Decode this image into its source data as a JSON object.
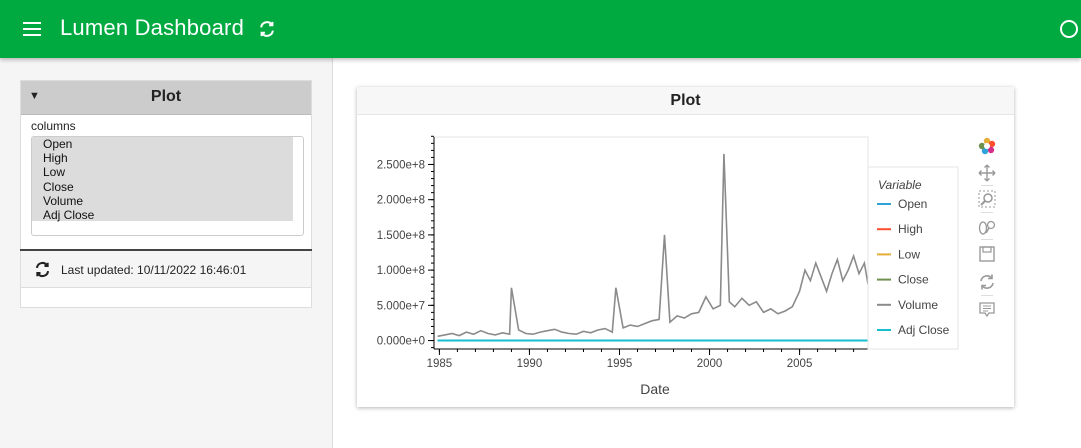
{
  "header": {
    "title": "Lumen Dashboard",
    "menu_icon": "hamburger-menu-icon",
    "refresh_icon": "refresh-icon",
    "bg_color": "#00aa41"
  },
  "sidebar": {
    "card_title": "Plot",
    "collapse_symbol": "▼",
    "columns_label": "columns",
    "options": [
      "Open",
      "High",
      "Low",
      "Close",
      "Volume",
      "Adj Close"
    ],
    "last_updated": "Last updated: 10/11/2022 16:46:01"
  },
  "main": {
    "plot_title": "Plot"
  },
  "chart_data": {
    "type": "line",
    "xlabel": "Date",
    "ylabel": "",
    "xlim": [
      1984.7,
      2008.8
    ],
    "ylim": [
      -12000000.0,
      289000000.0
    ],
    "x_ticks": [
      1985,
      1990,
      1995,
      2000,
      2005
    ],
    "y_ticks": [
      {
        "value": 0,
        "label": "0.000e+0"
      },
      {
        "value": 50000000,
        "label": "5.000e+7"
      },
      {
        "value": 100000000,
        "label": "1.000e+8"
      },
      {
        "value": 150000000,
        "label": "1.500e+8"
      },
      {
        "value": 200000000,
        "label": "2.000e+8"
      },
      {
        "value": 250000000,
        "label": "2.500e+8"
      }
    ],
    "legend_title": "Variable",
    "legend_position": "right",
    "series": [
      {
        "name": "Open",
        "color": "#30a2da",
        "x": [
          1984.9,
          2008.8
        ],
        "y": [
          0,
          0
        ]
      },
      {
        "name": "High",
        "color": "#fc4f30",
        "x": [
          1984.9,
          2008.8
        ],
        "y": [
          0,
          0
        ]
      },
      {
        "name": "Low",
        "color": "#e5ae38",
        "x": [
          1984.9,
          2008.8
        ],
        "y": [
          0,
          0
        ]
      },
      {
        "name": "Close",
        "color": "#6d904f",
        "x": [
          1984.9,
          2008.8
        ],
        "y": [
          0,
          0
        ]
      },
      {
        "name": "Volume",
        "color": "#8b8b8b",
        "x": [
          1984.9,
          1985.3,
          1985.7,
          1986.1,
          1986.5,
          1986.9,
          1987.3,
          1987.7,
          1988.1,
          1988.5,
          1988.9,
          1989.0,
          1989.4,
          1989.8,
          1990.2,
          1990.6,
          1991.0,
          1991.4,
          1991.8,
          1992.2,
          1992.6,
          1993.0,
          1993.4,
          1993.8,
          1994.2,
          1994.6,
          1994.8,
          1995.2,
          1995.6,
          1996.0,
          1996.4,
          1996.8,
          1997.2,
          1997.5,
          1997.8,
          1998.2,
          1998.6,
          1999.0,
          1999.4,
          1999.8,
          2000.2,
          2000.6,
          2000.8,
          2001.1,
          2001.4,
          2001.8,
          2002.2,
          2002.6,
          2003.0,
          2003.4,
          2003.8,
          2004.2,
          2004.6,
          2005.0,
          2005.3,
          2005.6,
          2005.9,
          2006.2,
          2006.5,
          2006.8,
          2007.1,
          2007.4,
          2007.7,
          2008.0,
          2008.3,
          2008.6,
          2008.8
        ],
        "y": [
          6000000,
          8000000,
          10000000,
          7000000,
          12000000,
          9000000,
          14000000,
          10000000,
          8000000,
          11000000,
          9000000,
          75000000,
          15000000,
          10000000,
          9000000,
          12000000,
          14000000,
          16000000,
          12000000,
          10000000,
          9000000,
          13000000,
          11000000,
          15000000,
          17000000,
          12000000,
          75000000,
          18000000,
          22000000,
          20000000,
          24000000,
          28000000,
          30000000,
          150000000,
          26000000,
          35000000,
          32000000,
          38000000,
          40000000,
          62000000,
          45000000,
          50000000,
          265000000,
          55000000,
          48000000,
          60000000,
          50000000,
          55000000,
          40000000,
          45000000,
          38000000,
          42000000,
          48000000,
          70000000,
          100000000,
          85000000,
          110000000,
          90000000,
          70000000,
          95000000,
          115000000,
          85000000,
          100000000,
          120000000,
          95000000,
          110000000,
          80000000
        ]
      },
      {
        "name": "Adj Close",
        "color": "#17becf",
        "x": [
          1984.9,
          2008.8
        ],
        "y": [
          0,
          0
        ]
      }
    ]
  }
}
